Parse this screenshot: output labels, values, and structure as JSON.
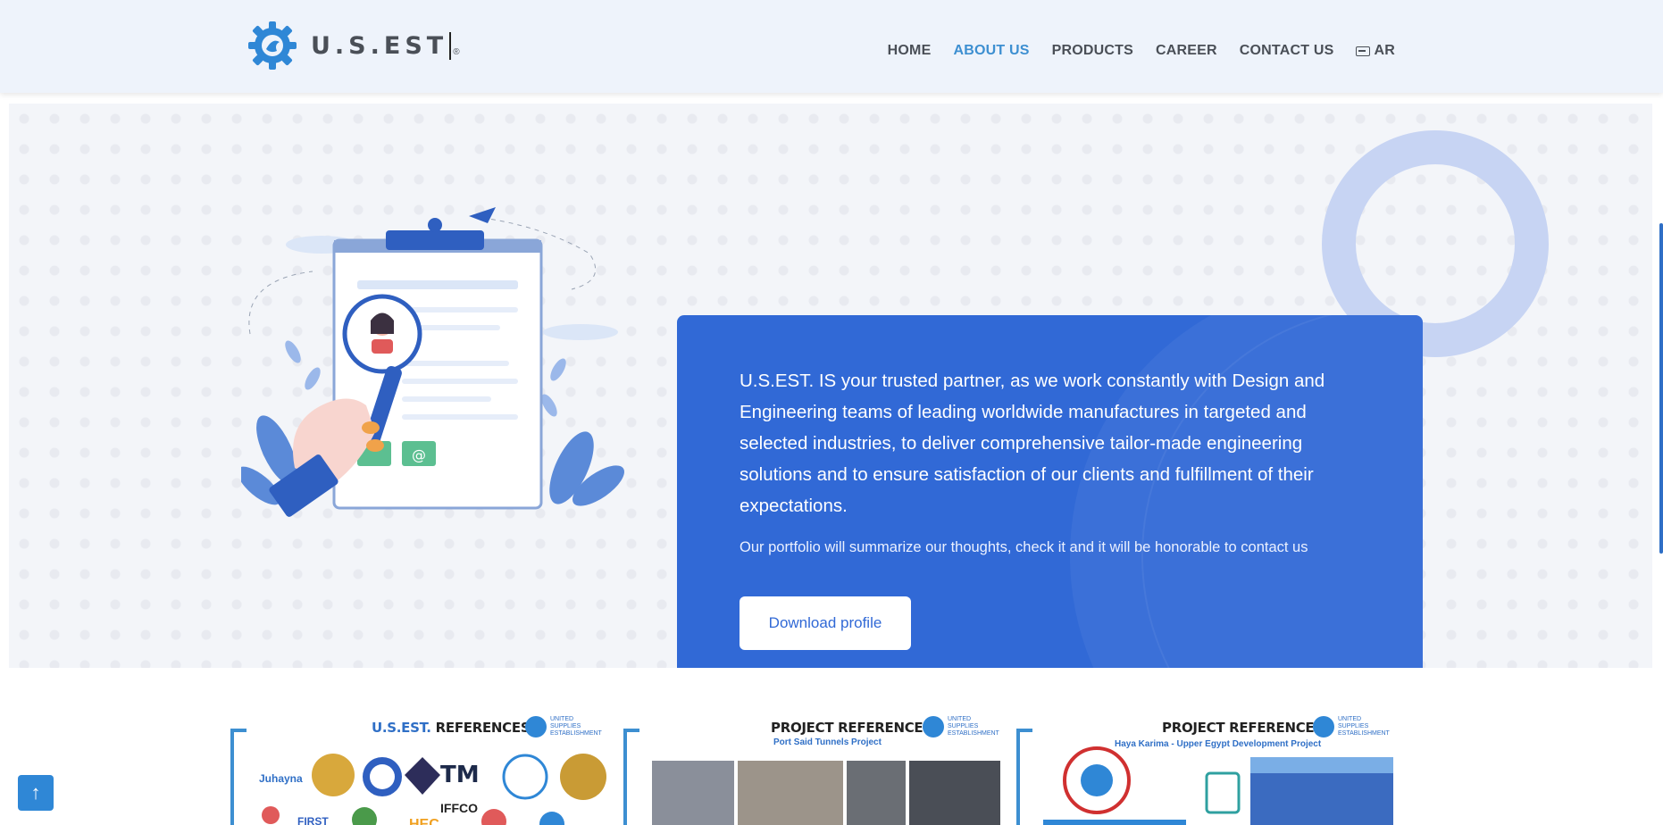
{
  "header": {
    "logo_text": "U.S.EST",
    "logo_mark": "®",
    "nav": [
      {
        "label": "HOME"
      },
      {
        "label": "ABOUT US"
      },
      {
        "label": "PRODUCTS"
      },
      {
        "label": "CAREER"
      },
      {
        "label": "CONTACT US"
      },
      {
        "label": "AR"
      }
    ],
    "active_color": "#3d8fd1"
  },
  "hero": {
    "main_text": "U.S.EST. IS your trusted partner, as we work constantly with Design and Engineering teams of leading worldwide manufactures in targeted and selected industries, to deliver comprehensive tailor-made engineering solutions and to ensure satisfaction of our clients and fulfillment of their expectations.",
    "sub_text": "Our portfolio will summarize our thoughts, check it and it will be honorable to contact us",
    "download_label": "Download profile",
    "card_color": "#3169d6"
  },
  "references": [
    {
      "title_accent": "U.S.EST.",
      "title": "REFERENCES",
      "brand": "UNITED SUPPLIES ESTABLISHMENT"
    },
    {
      "title": "PROJECT REFERENCE",
      "subtitle": "Port Said Tunnels Project",
      "brand": "UNITED SUPPLIES ESTABLISHMENT"
    },
    {
      "title": "PROJECT REFERENCE",
      "subtitle": "Haya Karima - Upper Egypt Development Project",
      "brand": "UNITED SUPPLIES ESTABLISHMENT"
    }
  ],
  "ref_logos": {
    "juhayna": "Juhayna",
    "tm": "TM",
    "iffco": "IFFCO",
    "first": "FIRST",
    "hec": "HEC"
  },
  "back_to_top_icon": "arrow-up-icon"
}
